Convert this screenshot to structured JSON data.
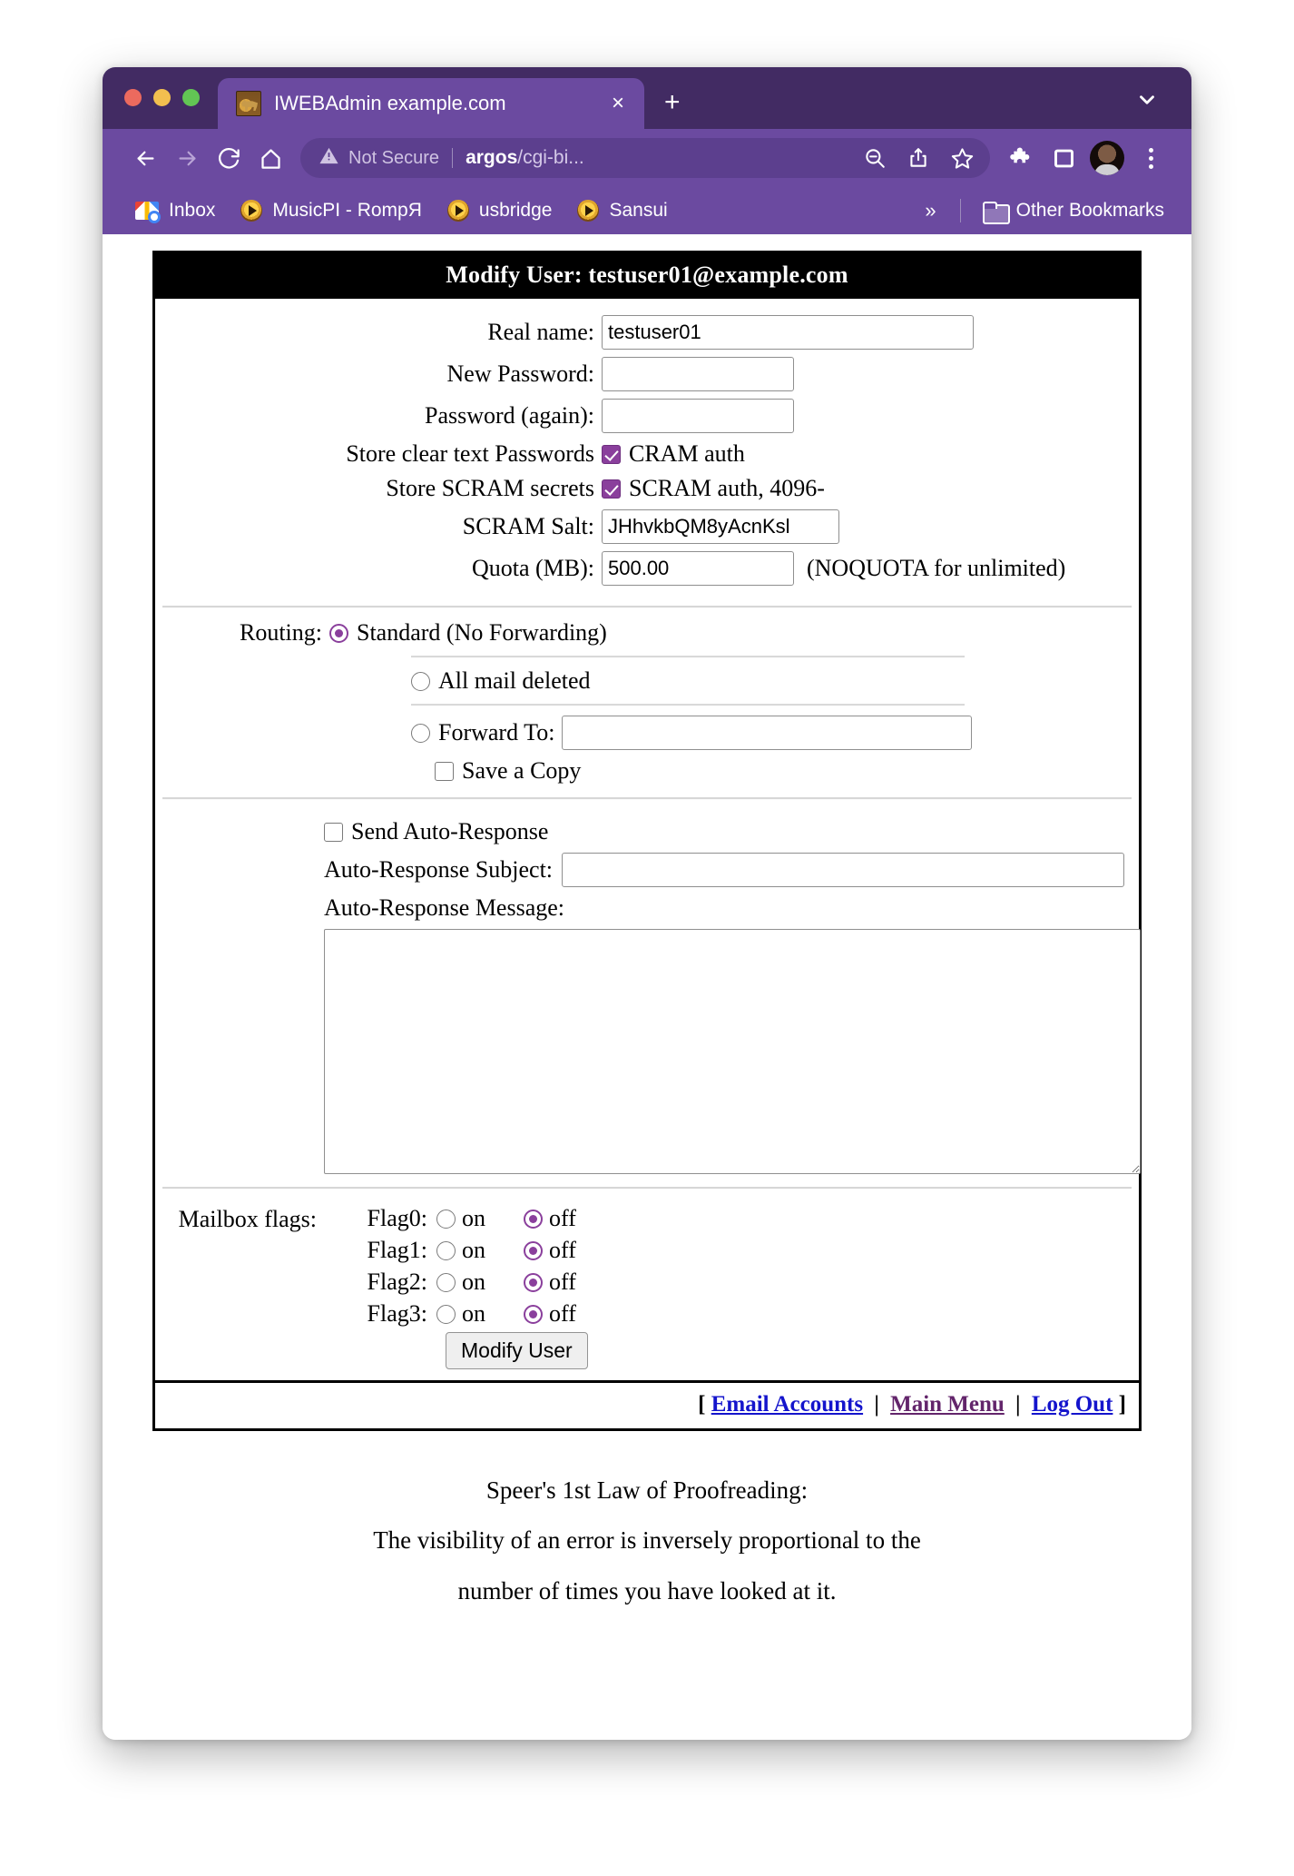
{
  "browser": {
    "tab": {
      "title": "IWEBAdmin example.com",
      "favicon": "horse-figurine-favicon",
      "close_label": "×"
    },
    "new_tab_label": "+",
    "tab_list_icon": "chevron-down-icon",
    "toolbar": {
      "back_icon": "back-arrow-icon",
      "forward_icon": "forward-arrow-icon",
      "reload_icon": "reload-icon",
      "home_icon": "home-icon",
      "security_label": "Not Secure",
      "warning_icon": "warning-triangle-icon",
      "url_host": "argos",
      "url_path": "/cgi-bi...",
      "zoom_icon": "zoom-out-icon",
      "share_icon": "share-icon",
      "bookmark_icon": "star-icon",
      "extensions_icon": "puzzle-piece-icon",
      "sidepanel_icon": "side-panel-icon",
      "profile_icon": "avatar",
      "menu_icon": "kebab-menu-icon"
    },
    "bookmarks": [
      {
        "label": "Inbox",
        "icon": "gmail-icon"
      },
      {
        "label": "MusicPI - RompЯ",
        "icon": "play-circle-icon"
      },
      {
        "label": "usbridge",
        "icon": "play-circle-icon"
      },
      {
        "label": "Sansui",
        "icon": "play-circle-icon"
      }
    ],
    "bookmarks_overflow": "»",
    "other_bookmarks": {
      "label": "Other Bookmarks",
      "icon": "folder-icon"
    }
  },
  "page": {
    "header": "Modify User: testuser01@example.com",
    "fields": {
      "real_name_label": "Real name:",
      "real_name_value": "testuser01",
      "new_password_label": "New Password:",
      "new_password_value": "",
      "password_again_label": "Password (again):",
      "password_again_value": "",
      "store_clear_label": "Store clear text Passwords",
      "cram_label": "CRAM auth",
      "cram_checked": true,
      "store_scram_label": "Store SCRAM secrets",
      "scram_label": "SCRAM auth, 4096-",
      "scram_checked": true,
      "scram_salt_label": "SCRAM Salt:",
      "scram_salt_value": "JHhvkbQM8yAcnKsl",
      "quota_label": "Quota (MB):",
      "quota_value": "500.00",
      "quota_note": "(NOQUOTA for unlimited)"
    },
    "routing": {
      "label": "Routing:",
      "standard_label": "Standard (No Forwarding)",
      "standard_selected": true,
      "deleted_label": "All mail deleted",
      "deleted_selected": false,
      "forward_label": "Forward To:",
      "forward_selected": false,
      "forward_value": "",
      "save_copy_label": "Save a Copy",
      "save_copy_checked": false
    },
    "autoresponse": {
      "send_label": "Send Auto-Response",
      "send_checked": false,
      "subject_label": "Auto-Response Subject:",
      "subject_value": "",
      "message_label": "Auto-Response Message:",
      "message_value": ""
    },
    "flags": {
      "label": "Mailbox flags:",
      "on_label": "on",
      "off_label": "off",
      "rows": [
        {
          "name": "Flag0:",
          "state": "off"
        },
        {
          "name": "Flag1:",
          "state": "off"
        },
        {
          "name": "Flag2:",
          "state": "off"
        },
        {
          "name": "Flag3:",
          "state": "off"
        }
      ]
    },
    "submit_label": "Modify User",
    "footer": {
      "open_bracket": "[",
      "close_bracket": "]",
      "separator": "|",
      "links": [
        {
          "label": "Email Accounts",
          "color": "#1414cc"
        },
        {
          "label": "Main Menu",
          "color": "#63256b"
        },
        {
          "label": "Log Out",
          "color": "#1414cc"
        }
      ]
    },
    "quote": {
      "line1": "Speer's 1st Law of Proofreading:",
      "line2": "The visibility of an error is inversely proportional to the",
      "line3": "number of times you have looked at it."
    }
  }
}
